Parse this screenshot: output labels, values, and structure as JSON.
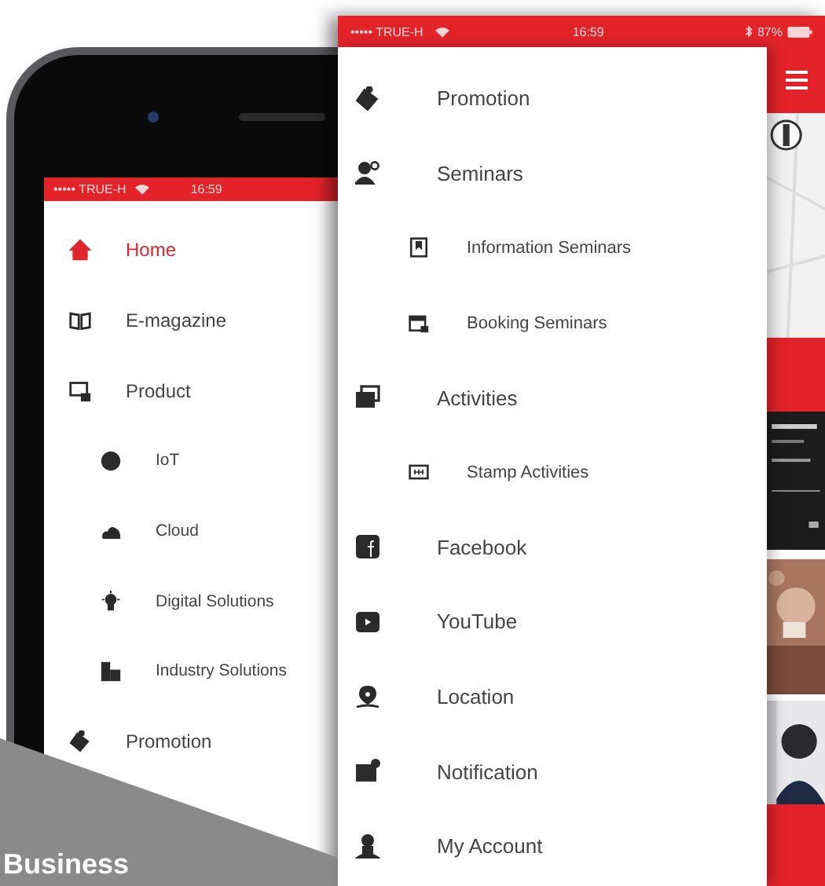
{
  "left_phone": {
    "status_bar": {
      "carrier": "••••• TRUE-H",
      "time": "16:59"
    },
    "menu": [
      {
        "label": "Home",
        "selected": true
      },
      {
        "label": "E-magazine",
        "selected": false
      },
      {
        "label": "Product",
        "selected": false,
        "children": [
          {
            "label": "IoT",
            "selected": false
          },
          {
            "label": "Cloud",
            "selected": false
          },
          {
            "label": "Digital Solutions",
            "selected": false
          },
          {
            "label": "Industry Solutions",
            "selected": false
          }
        ]
      },
      {
        "label": "Promotion",
        "selected": false
      }
    ]
  },
  "right_phone": {
    "status_bar": {
      "carrier": "••••• TRUE-H",
      "time": "16:59",
      "battery": "87%"
    },
    "menu": [
      {
        "label": "Promotion",
        "selected": false
      },
      {
        "label": "Seminars",
        "selected": false,
        "children": [
          {
            "label": "Information Seminars",
            "selected": false
          },
          {
            "label": "Booking Seminars",
            "selected": false
          }
        ]
      },
      {
        "label": "Activities",
        "selected": false,
        "children": [
          {
            "label": "Stamp Activities",
            "selected": false
          }
        ]
      },
      {
        "label": "Facebook",
        "selected": false
      },
      {
        "label": "YouTube",
        "selected": false
      },
      {
        "label": "Location",
        "selected": false
      },
      {
        "label": "Notification",
        "selected": false
      },
      {
        "label": "My Account",
        "selected": false
      }
    ]
  },
  "banner": {
    "title": "Business"
  }
}
